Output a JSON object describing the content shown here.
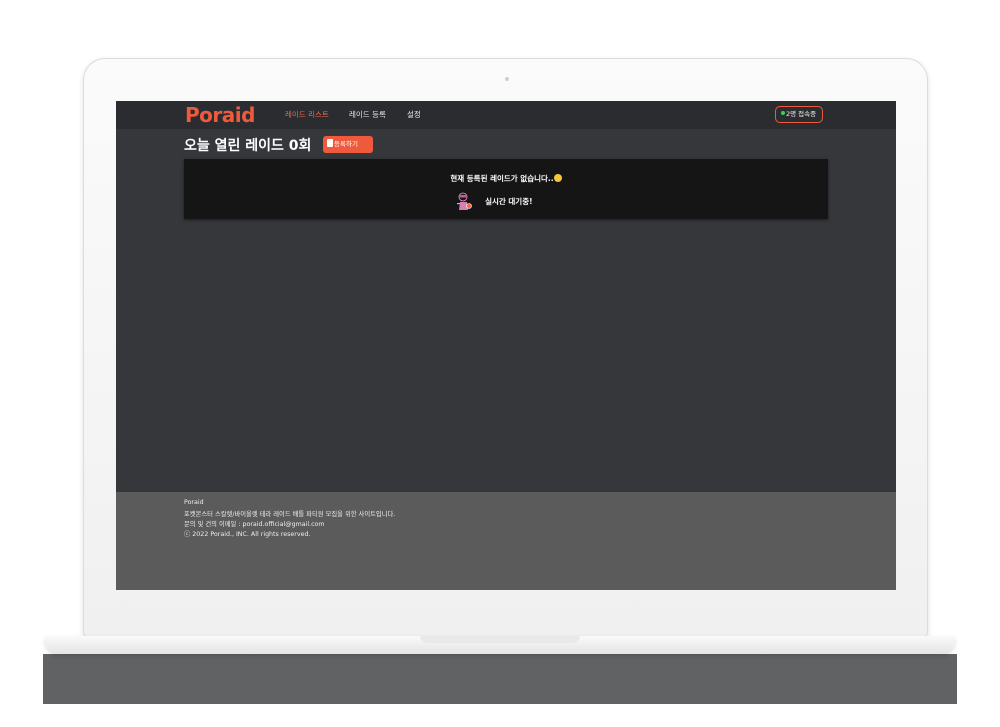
{
  "brand": {
    "logo_text": "Poraid",
    "accent_color": "#f05a3c"
  },
  "nav": {
    "items": [
      {
        "label": "레이드 리스트",
        "active": true
      },
      {
        "label": "레이드 등록",
        "active": false
      },
      {
        "label": "설정",
        "active": false
      }
    ],
    "online_status": {
      "text": "2명 접속중",
      "dot_color": "#3ccf4e"
    }
  },
  "main": {
    "title": "오늘 열린 레이드 0회",
    "register_button": "등록하기",
    "empty_state": {
      "message": "현재 등록된 레이드가 없습니다..",
      "emoji_icon": "sad-face-icon",
      "waiting_icon": "pokemon-trainer-icon",
      "waiting_text": "실시간 대기중!"
    }
  },
  "footer": {
    "lines": [
      "Poraid",
      "포켓몬스터 스칼렛/바이올렛 테라 레이드 배틀 파티원 모집을 위한 사이트입니다.",
      "문의 및 건의 이메일 : poraid.official@gmail.com",
      "ⓒ 2022 Poraid., INC. All rights reserved."
    ]
  }
}
